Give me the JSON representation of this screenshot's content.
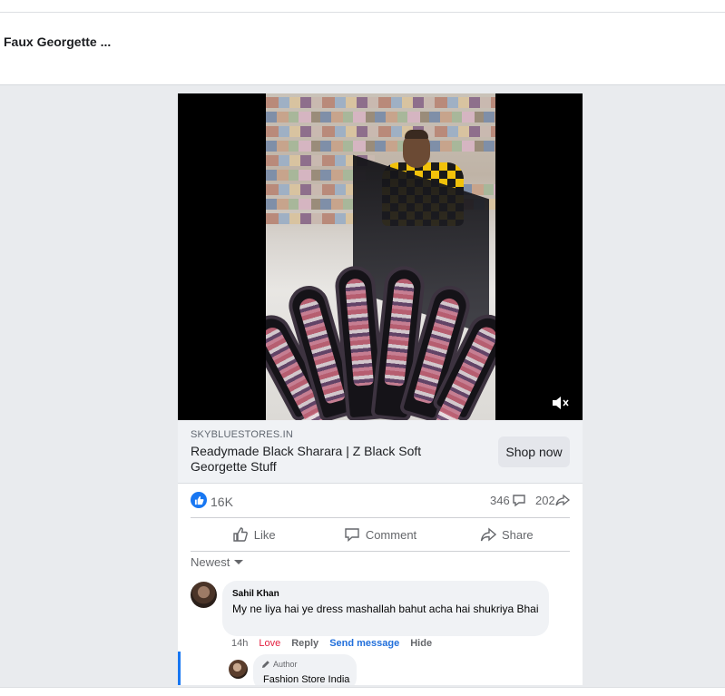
{
  "header": {
    "title": "Faux Georgette ..."
  },
  "video": {
    "muted": true,
    "mute_icon": "volume-muted-icon"
  },
  "ad": {
    "domain": "SKYBLUESTORES.IN",
    "title": "Readymade Black Sharara | Z Black Soft Georgette Stuff",
    "cta_label": "Shop now"
  },
  "stats": {
    "likes": "16K",
    "comments": "346",
    "shares": "202"
  },
  "actions": {
    "like": "Like",
    "comment": "Comment",
    "share": "Share"
  },
  "sort": {
    "label": "Newest"
  },
  "comments": [
    {
      "name": "Sahil Khan",
      "text": "My ne liya hai ye dress mashallah bahut acha hai shukriya Bhai",
      "time": "14h",
      "reaction": "Love",
      "reply": "Reply",
      "send_message": "Send message",
      "hide": "Hide"
    }
  ],
  "reply": {
    "badge": "Author",
    "name": "Fashion Store India"
  },
  "colors": {
    "accent": "#1877f2",
    "love": "#e41e3f",
    "link": "#216fdb",
    "page_bg": "#e9ebee"
  }
}
